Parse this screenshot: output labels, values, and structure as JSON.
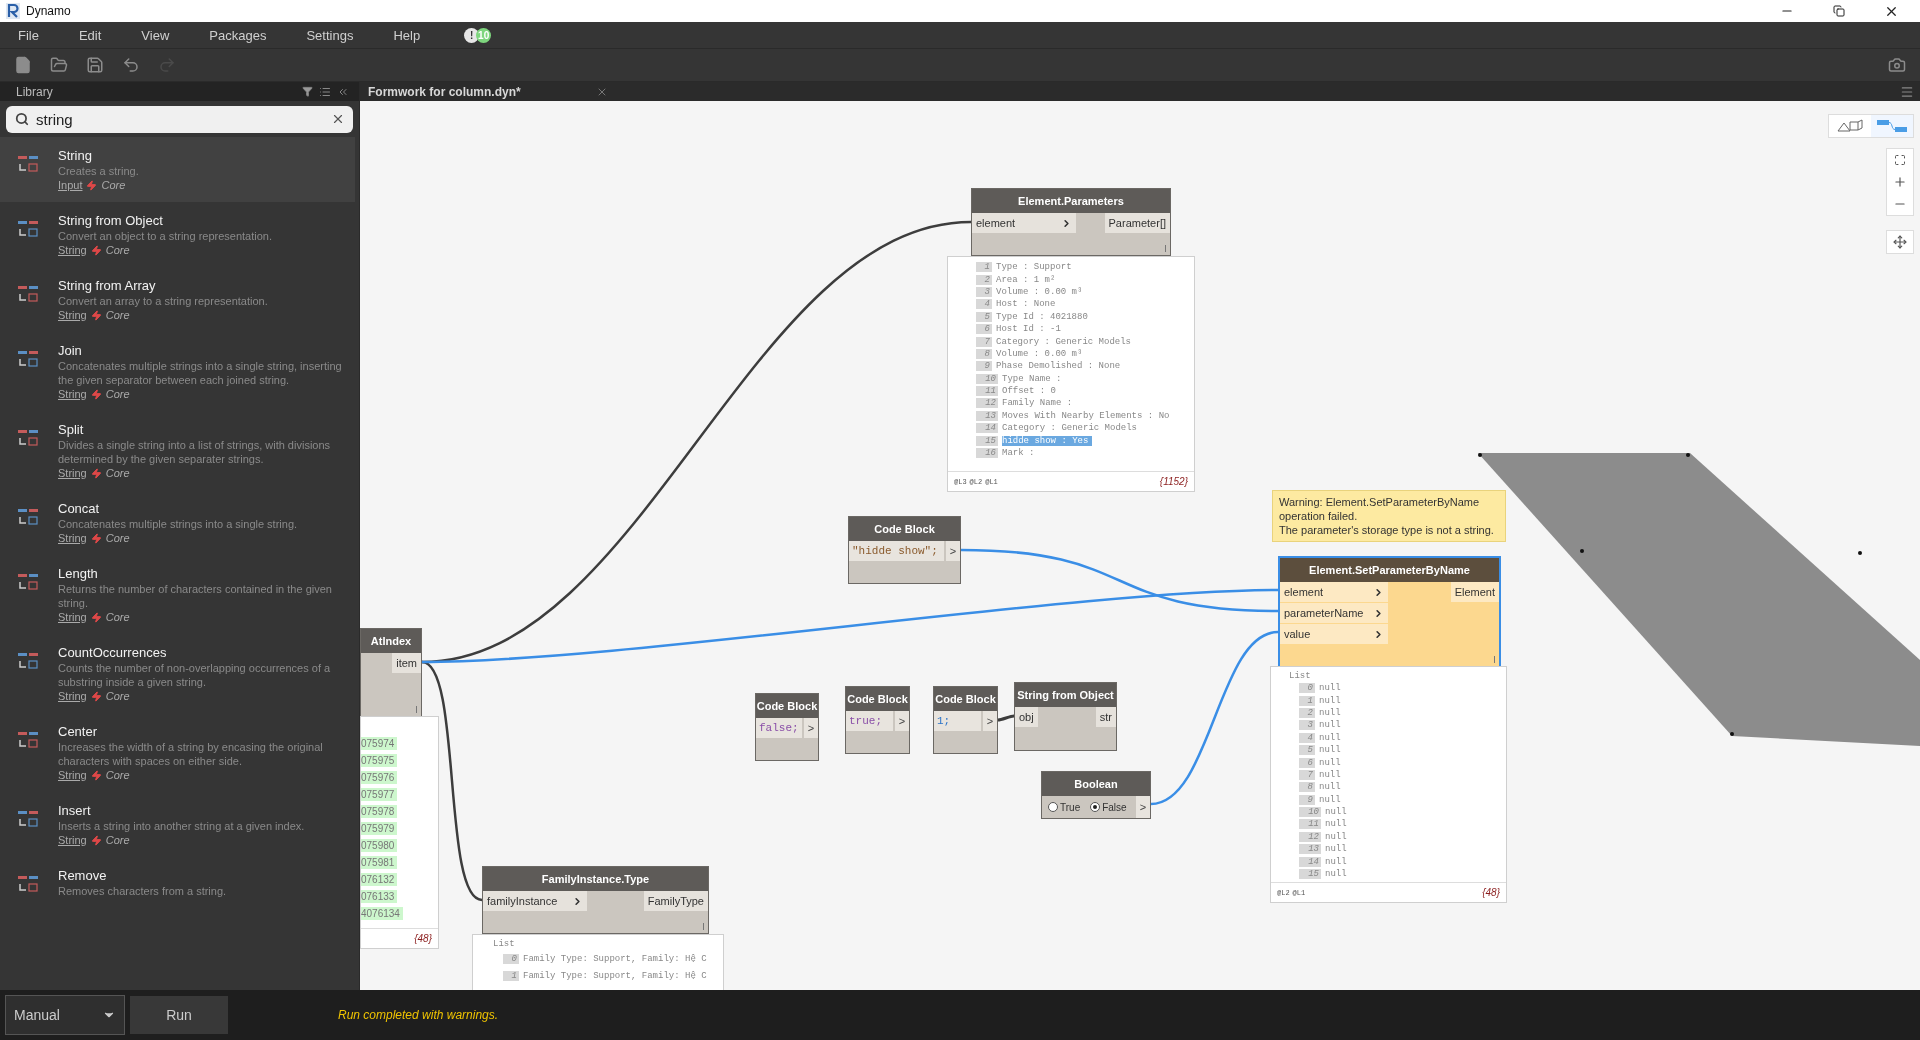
{
  "window": {
    "title": "Dynamo"
  },
  "menu": [
    {
      "label": "File"
    },
    {
      "label": "Edit"
    },
    {
      "label": "View"
    },
    {
      "label": "Packages"
    },
    {
      "label": "Settings"
    },
    {
      "label": "Help"
    }
  ],
  "notifications": [
    {
      "text": "!",
      "color": "#e6e6e6"
    },
    {
      "text": "10",
      "color": "#7ed67e"
    }
  ],
  "library": {
    "title": "Library",
    "search": {
      "value": "string"
    },
    "items": [
      {
        "name": "String",
        "description": "Creates a string.",
        "category": "Input",
        "group": "Core",
        "selected": true
      },
      {
        "name": "String from Object",
        "description": "Convert an object to a string representation.",
        "category": "String",
        "group": "Core",
        "selected": false
      },
      {
        "name": "String from Array",
        "description": "Convert an array to a string representation.",
        "category": "String",
        "group": "Core",
        "selected": false
      },
      {
        "name": "Join",
        "description": "Concatenates multiple strings into a single string, inserting the given separator between each joined string.",
        "category": "String",
        "group": "Core",
        "selected": false
      },
      {
        "name": "Split",
        "description": "Divides a single string into a list of strings, with divisions determined by the given separater strings.",
        "category": "String",
        "group": "Core",
        "selected": false
      },
      {
        "name": "Concat",
        "description": "Concatenates multiple strings into a single string.",
        "category": "String",
        "group": "Core",
        "selected": false
      },
      {
        "name": "Length",
        "description": "Returns the number of characters contained in the given string.",
        "category": "String",
        "group": "Core",
        "selected": false
      },
      {
        "name": "CountOccurrences",
        "description": "Counts the number of non-overlapping occurrences of a substring inside a given string.",
        "category": "String",
        "group": "Core",
        "selected": false
      },
      {
        "name": "Center",
        "description": "Increases the width of a string by encasing the original characters with spaces on either side.",
        "category": "String",
        "group": "Core",
        "selected": false
      },
      {
        "name": "Insert",
        "description": "Inserts a string into another string at a given index.",
        "category": "String",
        "group": "Core",
        "selected": false
      },
      {
        "name": "Remove",
        "description": "Removes characters from a string.",
        "selected": false
      }
    ]
  },
  "tabs": [
    {
      "label": "Formwork for column.dyn*",
      "selected": true
    }
  ],
  "nodes": [
    {
      "kind": "function",
      "title": "Element.Parameters",
      "inputs": [
        {
          "name": "element",
          "arrow": true
        }
      ],
      "outputs": [
        "Parameter[]"
      ],
      "lacing": true,
      "selected": false,
      "preview": {
        "kind": "list",
        "items": [
          {
            "index": "1",
            "text": "Type : Support",
            "selected": false
          },
          {
            "index": "2",
            "text": "Area : 1 m²",
            "selected": false
          },
          {
            "index": "3",
            "text": "Volume : 0.00 m³",
            "selected": false
          },
          {
            "index": "4",
            "text": "Host : None",
            "selected": false
          },
          {
            "index": "5",
            "text": "Type Id : 4021880",
            "selected": false
          },
          {
            "index": "6",
            "text": "Host Id : -1",
            "selected": false
          },
          {
            "index": "7",
            "text": "Category : Generic Models",
            "selected": false
          },
          {
            "index": "8",
            "text": "Volume : 0.00 m³",
            "selected": false
          },
          {
            "index": "9",
            "text": "Phase Demolished : None",
            "selected": false
          },
          {
            "index": "10",
            "text": "Type Name :",
            "selected": false
          },
          {
            "index": "11",
            "text": "Offset : 0",
            "selected": false
          },
          {
            "index": "12",
            "text": "Family Name :",
            "selected": false
          },
          {
            "index": "13",
            "text": "Moves With Nearby Elements : No",
            "selected": false
          },
          {
            "index": "14",
            "text": "Category : Generic Models",
            "selected": false
          },
          {
            "index": "15",
            "text": "hidde show : Yes",
            "selected": true
          },
          {
            "index": "16",
            "text": "Mark :",
            "selected": false
          }
        ],
        "levels": [
          "@L3",
          "@L2",
          "@L1"
        ],
        "count": "{1152}"
      }
    },
    {
      "kind": "code",
      "title": "Code Block",
      "code": "\"hidde show\";",
      "color": "#8a5a2c",
      "output": ">"
    },
    {
      "kind": "function",
      "title": "Element.SetParameterByName",
      "inputs": [
        {
          "name": "element",
          "arrow": true
        },
        {
          "name": "parameterName",
          "arrow": true
        },
        {
          "name": "value",
          "arrow": true
        }
      ],
      "outputs": [
        "Element"
      ],
      "lacing": true,
      "selected": true,
      "warning": [
        "Warning: Element.SetParameterByName operation failed.",
        "The parameter's storage type is not a string."
      ],
      "preview": {
        "kind": "list",
        "header": "List",
        "items": [
          {
            "index": "0",
            "text": "null"
          },
          {
            "index": "1",
            "text": "null"
          },
          {
            "index": "2",
            "text": "null"
          },
          {
            "index": "3",
            "text": "null"
          },
          {
            "index": "4",
            "text": "null"
          },
          {
            "index": "5",
            "text": "null"
          },
          {
            "index": "6",
            "text": "null"
          },
          {
            "index": "7",
            "text": "null"
          },
          {
            "index": "8",
            "text": "null"
          },
          {
            "index": "9",
            "text": "null"
          },
          {
            "index": "10",
            "text": "null"
          },
          {
            "index": "11",
            "text": "null"
          },
          {
            "index": "12",
            "text": "null"
          },
          {
            "index": "13",
            "text": "null"
          },
          {
            "index": "14",
            "text": "null"
          },
          {
            "index": "15",
            "text": "null"
          }
        ],
        "levels": [
          "@L2",
          "@L1"
        ],
        "count": "{48}"
      }
    },
    {
      "kind": "function",
      "title": "AtIndex",
      "outputs": [
        "item"
      ],
      "lacing": true,
      "selected": false,
      "preview": {
        "kind": "values",
        "items": [
          {
            "text": "075974"
          },
          {
            "text": "075975"
          },
          {
            "text": "075976"
          },
          {
            "text": "075977"
          },
          {
            "text": "075978"
          },
          {
            "text": "075979"
          },
          {
            "text": "075980"
          },
          {
            "text": "075981"
          },
          {
            "text": "076132"
          },
          {
            "text": "076133"
          },
          {
            "text": "4076134"
          }
        ],
        "count": "{48}"
      }
    },
    {
      "kind": "code",
      "title": "Code Block",
      "code": "false;",
      "color": "#8a4fa8",
      "output": ">"
    },
    {
      "kind": "code",
      "title": "Code Block",
      "code": "true;",
      "color": "#8a4fa8",
      "output": ">"
    },
    {
      "kind": "code",
      "title": "Code Block",
      "code": "1;",
      "color": "#2b73c8",
      "output": ">"
    },
    {
      "kind": "function",
      "title": "String from Object",
      "inputs": [
        {
          "name": "obj",
          "arrow": false
        }
      ],
      "outputs": [
        "str"
      ],
      "lacing": false,
      "selected": false
    },
    {
      "kind": "boolean",
      "title": "Boolean",
      "options": [
        {
          "label": "True",
          "selected": false
        },
        {
          "label": "False",
          "selected": true
        }
      ],
      "output": ">"
    },
    {
      "kind": "function",
      "title": "FamilyInstance.Type",
      "inputs": [
        {
          "name": "familyInstance",
          "arrow": true
        }
      ],
      "outputs": [
        "FamilyType"
      ],
      "lacing": true,
      "selected": false,
      "preview": {
        "kind": "list",
        "header": "List",
        "items": [
          {
            "index": "0",
            "text": "Family Type: Support, Family: Hệ C"
          },
          {
            "index": "1",
            "text": "Family Type: Support, Family: Hệ C"
          }
        ]
      }
    }
  ],
  "bottom_bar": {
    "run_mode": "Manual",
    "run_button": "Run",
    "status": "Run completed with warnings."
  }
}
